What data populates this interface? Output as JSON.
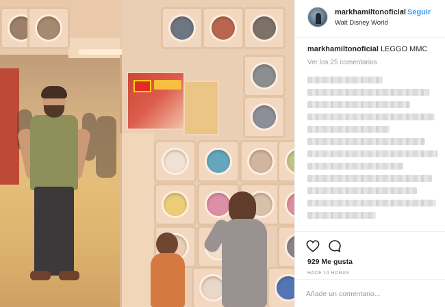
{
  "post": {
    "username": "markhamiltonoficial",
    "follow_label": "Seguir",
    "separator": "•",
    "location": "Walt Disney World",
    "avatar_icon": "profile-avatar"
  },
  "caption": {
    "username": "markhamiltonoficial",
    "text": " LEGGO MMC"
  },
  "comments": {
    "view_all_label": "Ver los 25 comentarios",
    "blurred": true
  },
  "actions": {
    "like_icon": "heart-icon",
    "comment_icon": "comment-icon"
  },
  "likes_label": "929 Me gusta",
  "timestamp": "HACE 14 HORAS",
  "add_comment": {
    "placeholder": "Añade un comentario..."
  },
  "colors": {
    "accent": "#3897f0",
    "text": "#262626",
    "muted": "#999999",
    "border": "#efefef"
  }
}
